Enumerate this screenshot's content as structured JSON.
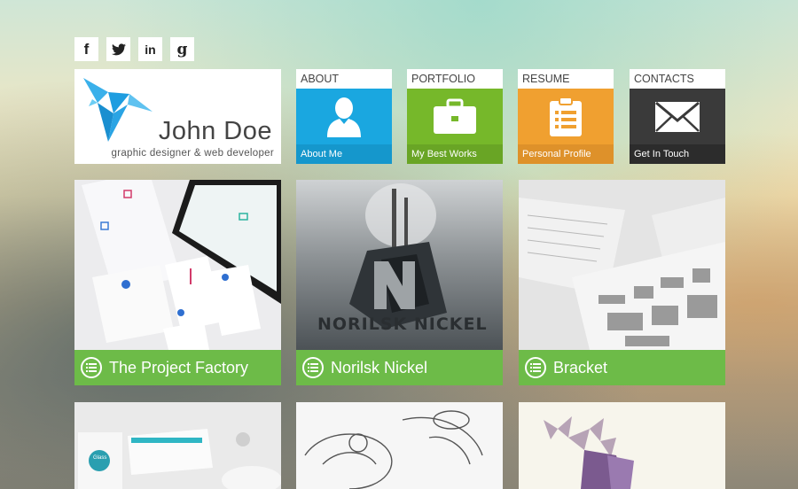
{
  "social": [
    {
      "name": "facebook",
      "glyph": "f"
    },
    {
      "name": "twitter",
      "glyph": ""
    },
    {
      "name": "linkedin",
      "glyph": "in"
    },
    {
      "name": "google",
      "glyph": "g"
    }
  ],
  "logo": {
    "name": "John Doe",
    "subtitle": "graphic designer & web developer"
  },
  "nav": [
    {
      "title": "ABOUT",
      "footer": "About Me",
      "icon": "user-icon",
      "color": "#1aa7e0"
    },
    {
      "title": "PORTFOLIO",
      "footer": "My Best Works",
      "icon": "briefcase-icon",
      "color": "#76b82a"
    },
    {
      "title": "RESUME",
      "footer": "Personal Profile",
      "icon": "clipboard-icon",
      "color": "#f0a030"
    },
    {
      "title": "CONTACTS",
      "footer": "Get In Touch",
      "icon": "envelope-icon",
      "color": "#3a3a3a"
    }
  ],
  "portfolio": [
    {
      "title": "The Project Factory",
      "thumb": "stationery-image"
    },
    {
      "title": "Norilsk Nickel",
      "thumb": "norilsk-image",
      "thumb_text": "NORILSK NICKEL"
    },
    {
      "title": "Bracket",
      "thumb": "bracket-image"
    },
    {
      "title": "",
      "thumb": "glass-stationery-image",
      "thumb_text": "Glass"
    },
    {
      "title": "",
      "thumb": "sketch-image"
    },
    {
      "title": "",
      "thumb": "deer-image"
    }
  ],
  "colors": {
    "caption_green": "#6dbb48"
  }
}
